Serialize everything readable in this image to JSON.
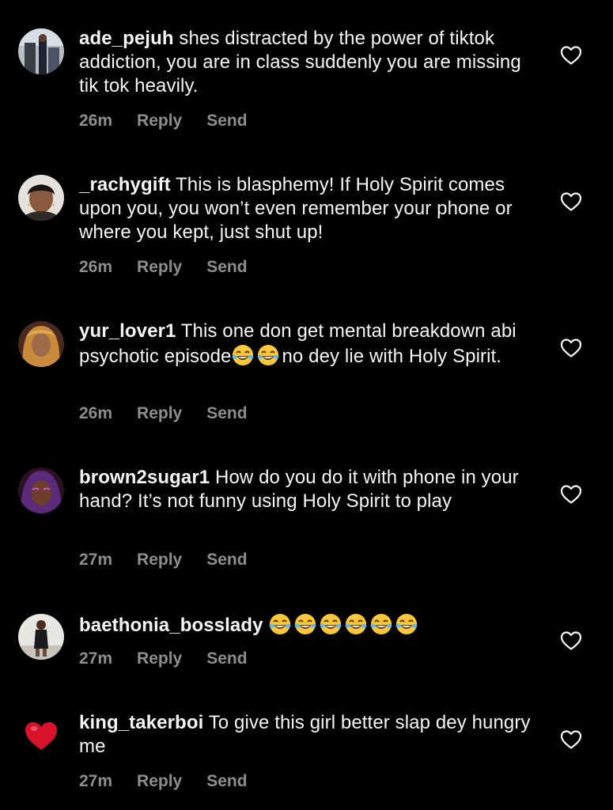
{
  "comments": [
    {
      "username": "ade_pejuh",
      "text": " shes distracted by the power of tiktok addiction, you are in class suddenly you are missing tik tok heavily.",
      "time": "26m",
      "reply": "Reply",
      "send": "Send",
      "avatar_icon": "avatar-photo-icon"
    },
    {
      "username": "_rachygift",
      "text": " This is blasphemy! If Holy Spirit comes upon you, you won’t even remember your phone or where you kept, just shut up!",
      "time": "26m",
      "reply": "Reply",
      "send": "Send",
      "avatar_icon": "avatar-photo-icon"
    },
    {
      "username": "yur_lover1",
      "text_before": " This one don get mental breakdown abi psychotic episode",
      "emoji": "😂😂",
      "text_after": "no dey lie with Holy Spirit.",
      "time": "26m",
      "reply": "Reply",
      "send": "Send",
      "avatar_icon": "avatar-photo-icon"
    },
    {
      "username": "brown2sugar1",
      "text": " How do you do it with phone in your hand? It’s not funny using Holy Spirit to play",
      "time": "27m",
      "reply": "Reply",
      "send": "Send",
      "avatar_icon": "avatar-photo-icon"
    },
    {
      "username": "baethonia_bosslady",
      "emoji": "😂😂😂😂😂😂",
      "time": "27m",
      "reply": "Reply",
      "send": "Send",
      "avatar_icon": "avatar-photo-icon"
    },
    {
      "username": "king_takerboi",
      "text": " To give this girl better slap dey hungry me",
      "time": "27m",
      "reply": "Reply",
      "send": "Send",
      "avatar_icon": "red-heart-avatar-icon"
    }
  ],
  "colors": {
    "background": "#000000",
    "text": "#f5f5f5",
    "meta": "#8e8e8e"
  },
  "icons": {
    "like": "heart-outline-icon",
    "laughing": "face-with-tears-of-joy-icon"
  }
}
